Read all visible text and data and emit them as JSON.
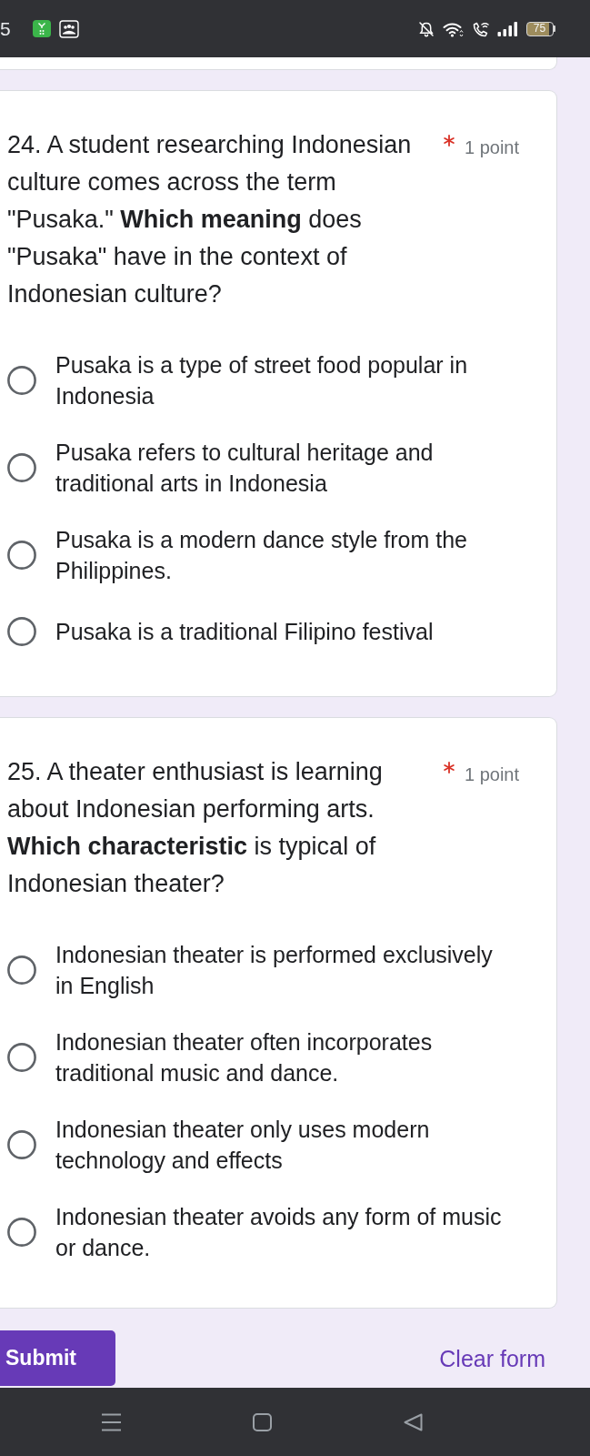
{
  "status_bar": {
    "time": "5",
    "battery": "75"
  },
  "questions": [
    {
      "title": "24. A student researching Indonesian culture comes across the term \"Pusaka.\" **Which meaning** does \"Pusaka\" have in the context of Indonesian culture?",
      "required": true,
      "points": "1 point",
      "options": [
        {
          "label": "Pusaka is a type of street food popular in Indonesia",
          "selected": false
        },
        {
          "label": "Pusaka refers to cultural heritage and traditional arts in Indonesia",
          "selected": false
        },
        {
          "label": "Pusaka is a modern dance style from the Philippines.",
          "selected": false
        },
        {
          "label": "Pusaka is a traditional Filipino festival",
          "selected": false
        }
      ]
    },
    {
      "title": "25. A theater enthusiast is learning about Indonesian performing arts. **Which characteristic** is typical of Indonesian theater?",
      "required": true,
      "points": "1 point",
      "options": [
        {
          "label": "Indonesian theater is performed exclusively in English",
          "selected": false
        },
        {
          "label": "Indonesian theater often incorporates traditional music and dance.",
          "selected": false
        },
        {
          "label": "Indonesian theater only uses modern technology and effects",
          "selected": false
        },
        {
          "label": "Indonesian theater avoids any form of music or dance.",
          "selected": false
        }
      ]
    }
  ],
  "actions": {
    "submit": "Submit",
    "clear": "Clear form"
  }
}
